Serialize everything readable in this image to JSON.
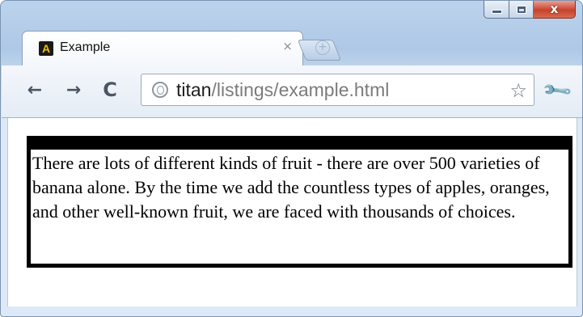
{
  "window": {
    "controls": {
      "minimize_icon": "minimize-icon",
      "maximize_icon": "maximize-icon",
      "close_icon": "close-icon",
      "close_glyph": "x"
    }
  },
  "tab": {
    "title": "Example",
    "favicon_letter": "A",
    "close_glyph": "×",
    "new_tab_glyph": "+"
  },
  "toolbar": {
    "back_glyph": "←",
    "forward_glyph": "→",
    "reload_glyph": "C",
    "address": {
      "host": "titan",
      "path": "/listings/example.html"
    },
    "bookmark_glyph": "☆",
    "menu_glyph": "🔧"
  },
  "page": {
    "paragraph": "There are lots of different kinds of fruit - there are over 500 varieties of banana alone. By the time we add the countless types of apples, oranges, and other well-known fruit, we are faced with thousands of choices."
  },
  "colors": {
    "frame": "#aec8e6",
    "close_button": "#c7422d",
    "box_border": "#000000"
  }
}
